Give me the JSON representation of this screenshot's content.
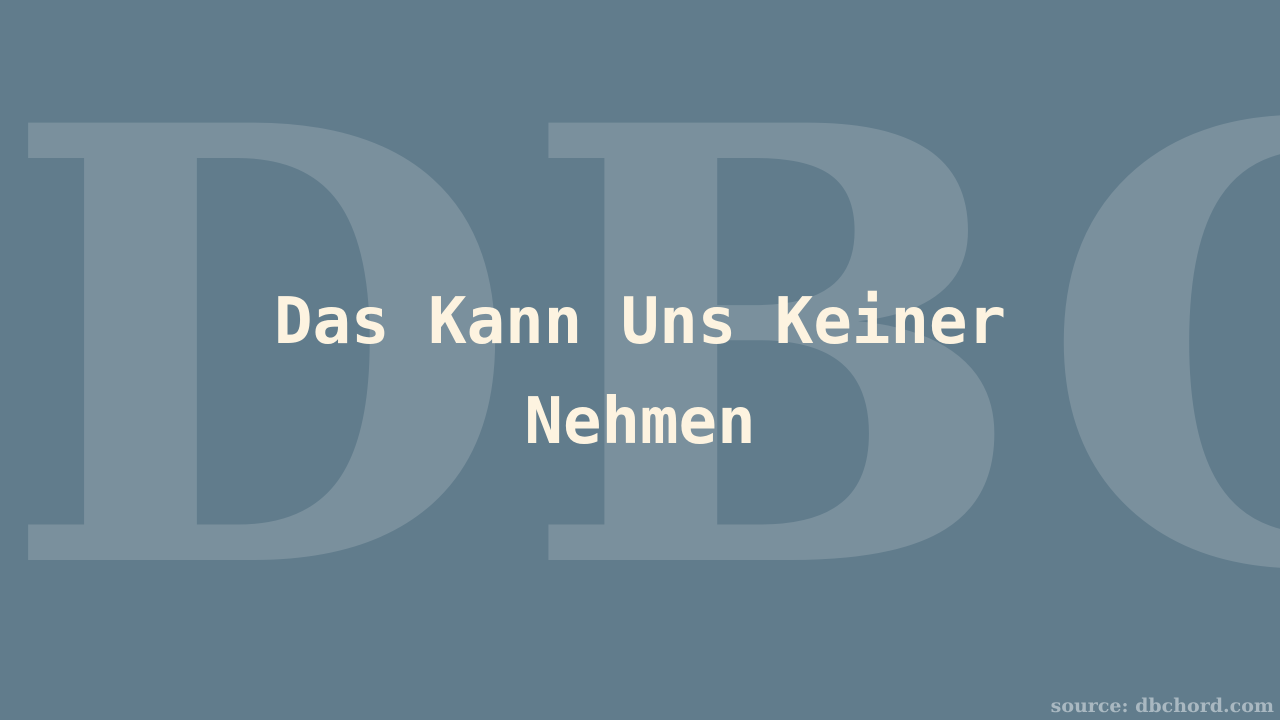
{
  "watermark": {
    "text": "DBC"
  },
  "song": {
    "title": "Das Kann Uns Keiner Nehmen"
  },
  "source": {
    "label": "source: dbchord.com"
  },
  "colors": {
    "background": "#617c8c",
    "watermark": "#8b9ea9",
    "title": "#fdf3e0",
    "source": "#a9b8c1"
  }
}
